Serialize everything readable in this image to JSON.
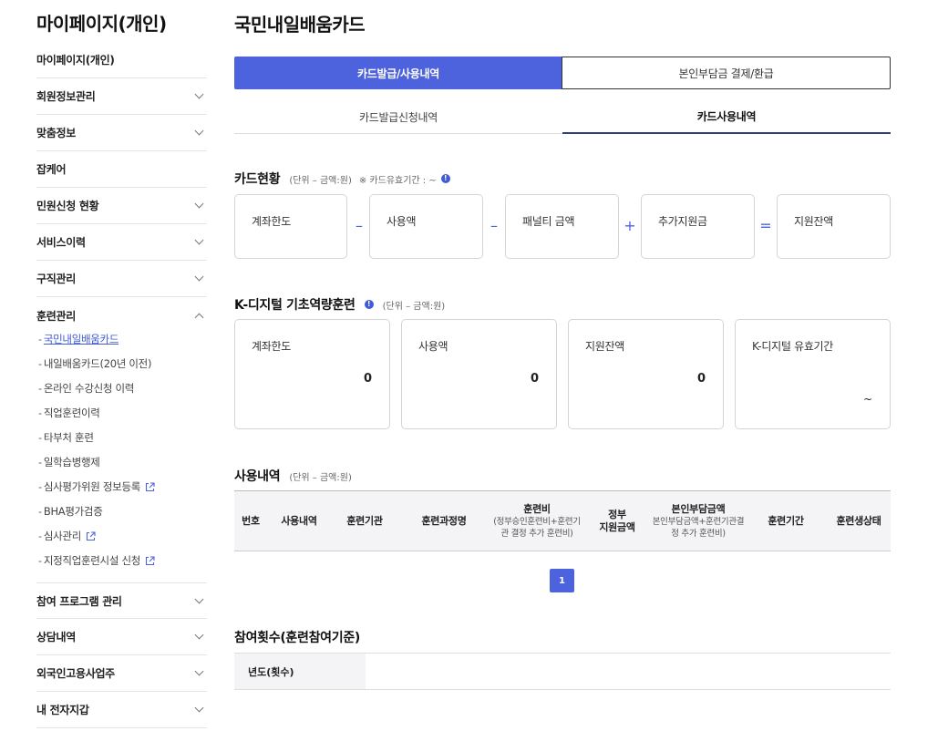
{
  "sidebar": {
    "title": "마이페이지(개인)",
    "items": [
      {
        "label": "마이페이지(개인)"
      },
      {
        "label": "회원정보관리"
      },
      {
        "label": "맞춤정보"
      },
      {
        "label": "잡케어"
      },
      {
        "label": "민원신청 현황"
      },
      {
        "label": "서비스이력"
      },
      {
        "label": "구직관리"
      },
      {
        "label": "훈련관리"
      },
      {
        "label": "참여 프로그램 관리"
      },
      {
        "label": "상담내역"
      },
      {
        "label": "외국인고용사업주"
      },
      {
        "label": "내 전자지갑"
      }
    ],
    "training_sub": [
      {
        "label": "국민내일배움카드"
      },
      {
        "label": "내일배움카드(20년 이전)"
      },
      {
        "label": "온라인 수강신청 이력"
      },
      {
        "label": "직업훈련이력"
      },
      {
        "label": "타부처 훈련"
      },
      {
        "label": "일학습병행제"
      },
      {
        "label": "심사평가위원 정보등록"
      },
      {
        "label": "BHA평가검증"
      },
      {
        "label": "심사관리"
      },
      {
        "label": "지정직업훈련시설 신청"
      }
    ]
  },
  "page": {
    "title": "국민내일배움카드"
  },
  "tabs": {
    "main": [
      "카드발급/사용내역",
      "본인부담금 결제/환급"
    ],
    "sub": [
      "카드발급신청내역",
      "카드사용내역"
    ]
  },
  "card_status": {
    "title": "카드현황",
    "unit": "(단위 – 금액:원)",
    "validity": "※ 카드유효기간 : ~",
    "boxes": [
      "계좌한도",
      "사용액",
      "패널티 금액",
      "추가지원금",
      "지원잔액"
    ],
    "operators": [
      "–",
      "–",
      "+",
      "="
    ]
  },
  "kdigital": {
    "title": "K-디지털 기초역량훈련",
    "unit": "(단위 – 금액:원)",
    "boxes": [
      {
        "label": "계좌한도",
        "value": "0"
      },
      {
        "label": "사용액",
        "value": "0"
      },
      {
        "label": "지원잔액",
        "value": "0"
      },
      {
        "label": "K-디지털 유효기간",
        "value": "~"
      }
    ]
  },
  "usage": {
    "title": "사용내역",
    "unit": "(단위 – 금액:원)",
    "headers": {
      "no": "번호",
      "usage": "사용내역",
      "institution": "훈련기관",
      "course": "훈련과정명",
      "fee": "훈련비",
      "fee_note": "(정부승인훈련비+훈련기관 결정 추가 훈련비)",
      "gov_1": "정부",
      "gov_2": "지원금액",
      "self": "본인부담금액",
      "self_note": "본인부담금액+훈련기관결정 추가 훈련비)",
      "period": "훈련기간",
      "status": "훈련생상태"
    },
    "page": "1"
  },
  "participation": {
    "title": "참여횟수(훈련참여기준)",
    "row_label": "년도(횟수)"
  },
  "colors": {
    "accent": "#4d63de",
    "link": "#3f5bd6"
  }
}
